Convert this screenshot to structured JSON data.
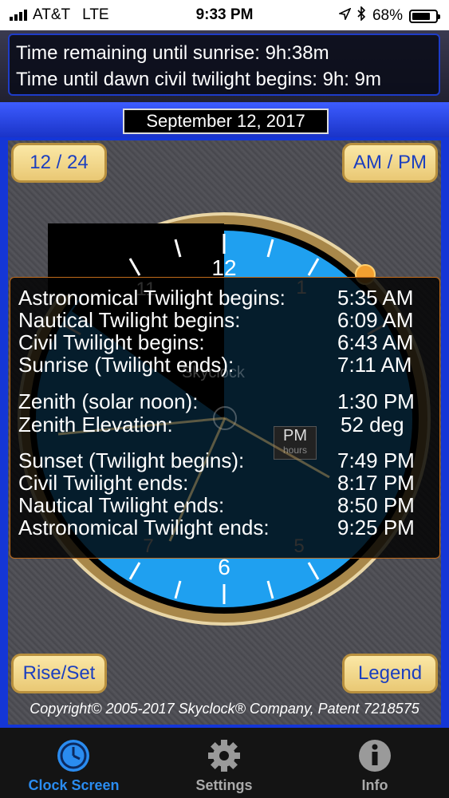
{
  "status_bar": {
    "carrier": "AT&T",
    "network": "LTE",
    "time": "9:33 PM",
    "battery": "68%"
  },
  "info": {
    "line1": "Time remaining until sunrise:  9h:38m",
    "line2": "Time until dawn civil twilight begins:  9h: 9m"
  },
  "date": "September 12, 2017",
  "buttons": {
    "format": "12 / 24",
    "ampm": "AM / PM",
    "riseset": "Rise/Set",
    "legend": "Legend"
  },
  "clock": {
    "brand": "Skyclock",
    "labels": [
      "12",
      "11",
      "1",
      "7",
      "6",
      "5"
    ],
    "mode_label": "PM",
    "mode_sub": "hours"
  },
  "times": [
    {
      "label": "Astronomical Twilight begins:",
      "value": "5:35 AM"
    },
    {
      "label": "Nautical Twilight begins:",
      "value": "6:09 AM"
    },
    {
      "label": "Civil Twilight begins:",
      "value": "6:43 AM"
    },
    {
      "label": "Sunrise (Twilight ends):",
      "value": "7:11 AM"
    },
    {
      "label": "Zenith (solar noon):",
      "value": "1:30 PM"
    },
    {
      "label": "Zenith Elevation:",
      "value": "52 deg"
    },
    {
      "label": "Sunset (Twilight begins):",
      "value": "7:49 PM"
    },
    {
      "label": "Civil Twilight ends:",
      "value": "8:17 PM"
    },
    {
      "label": "Nautical Twilight ends:",
      "value": "8:50 PM"
    },
    {
      "label": "Astronomical Twilight ends:",
      "value": "9:25 PM"
    }
  ],
  "copyright": "Copyright© 2005-2017 Skyclock® Company, Patent 7218575",
  "tabs": [
    {
      "label": "Clock Screen",
      "icon": "clock-icon",
      "active": true
    },
    {
      "label": "Settings",
      "icon": "gear-icon",
      "active": false
    },
    {
      "label": "Info",
      "icon": "info-icon",
      "active": false
    }
  ],
  "colors": {
    "accent_blue": "#1436d6",
    "tab_active": "#2a8cf0",
    "button_gold": "#e9c874",
    "sky_blue": "#1fa0f0"
  }
}
